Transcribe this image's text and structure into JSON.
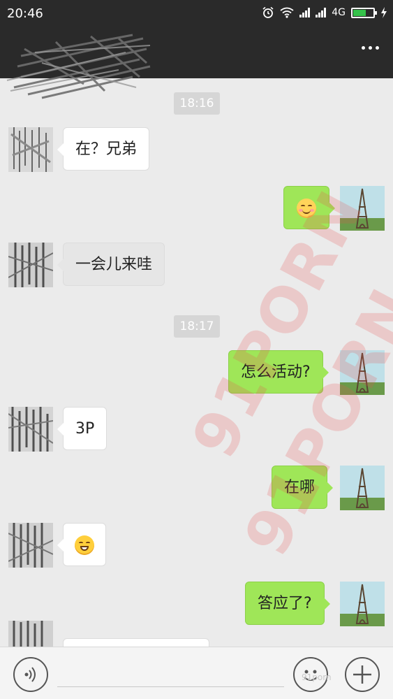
{
  "status_bar": {
    "time": "20:46",
    "network": "4G",
    "icons": [
      "alarm-icon",
      "wifi-icon",
      "signal-icon",
      "signal-icon",
      "battery-icon",
      "charging-icon"
    ]
  },
  "header": {
    "more_icon": "more-dots-icon"
  },
  "timestamps": [
    "18:16",
    "18:17"
  ],
  "messages": [
    {
      "from": "other",
      "text": "在？兄弟"
    },
    {
      "from": "me",
      "emoji": "smiling-blush-emoji"
    },
    {
      "from": "other",
      "text": "一会儿来哇"
    },
    {
      "from": "me",
      "text": "怎么活动?"
    },
    {
      "from": "other",
      "text": "3P"
    },
    {
      "from": "me",
      "text": "在哪"
    },
    {
      "from": "other",
      "emoji": "grinning-emoji"
    },
    {
      "from": "me",
      "text": "答应了?"
    }
  ],
  "bottom_bar": {
    "voice_icon": "voice-icon",
    "emoji_icon": "emoji-face-icon",
    "plus_icon": "plus-icon",
    "watermark": "91porn"
  },
  "watermarks": [
    "91PORN",
    "91PORN"
  ],
  "colors": {
    "header_bg": "#2a2a2a",
    "chat_bg": "#ebebeb",
    "my_bubble": "#9fe658",
    "other_bubble": "#ffffff",
    "battery_fill": "#35c24a"
  }
}
